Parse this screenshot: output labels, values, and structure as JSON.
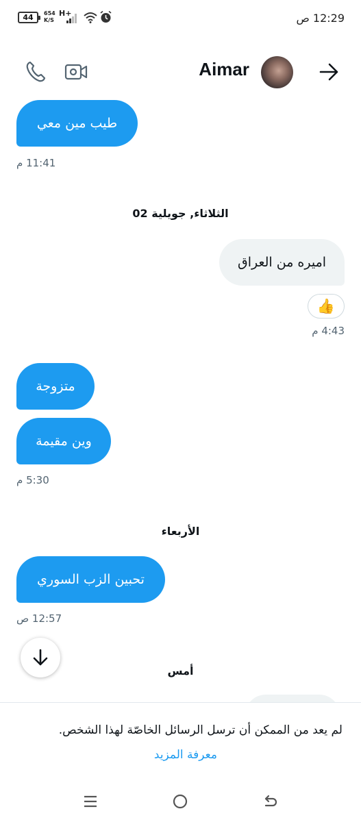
{
  "status_bar": {
    "battery": "44",
    "net_speed": "654",
    "net_speed_unit": "K/S",
    "network_type": "H+",
    "time": "12:29 ص",
    "icons": [
      "battery-icon",
      "signal-icon",
      "wifi-icon",
      "alarm-icon"
    ]
  },
  "header": {
    "contact_name": "Aimar",
    "icons": [
      "back-arrow-icon",
      "avatar",
      "video-call-icon",
      "phone-icon"
    ]
  },
  "messages": [
    {
      "text": "طيب مين معي",
      "direction": "incoming"
    },
    {
      "time": "11:41 م"
    },
    {
      "day_separator": "الثلاثاء, جويلية 02"
    },
    {
      "text": "اميره من العراق",
      "direction": "outgoing",
      "reaction": "👍"
    },
    {
      "time": "4:43 م"
    },
    {
      "text": "متزوجة",
      "direction": "incoming"
    },
    {
      "text": "وين مقيمة",
      "direction": "incoming"
    },
    {
      "time": "5:30 م"
    },
    {
      "day_separator": "الأربعاء"
    },
    {
      "text": "تحبين الزب السوري",
      "direction": "incoming"
    },
    {
      "time": "12:57 ص"
    },
    {
      "day_separator": "أمس"
    }
  ],
  "footer": {
    "notice": "لم يعد من الممكن أن ترسل الرسائل الخاصّة لهذا الشخص.",
    "learn_more": "معرفة المزيد"
  },
  "nav_bar": {
    "icons": [
      "menu-icon",
      "home-icon",
      "back-icon"
    ]
  },
  "colors": {
    "accent": "#1d9bf0",
    "outgoing_bubble": "#eff3f4",
    "muted_text": "#536471"
  }
}
